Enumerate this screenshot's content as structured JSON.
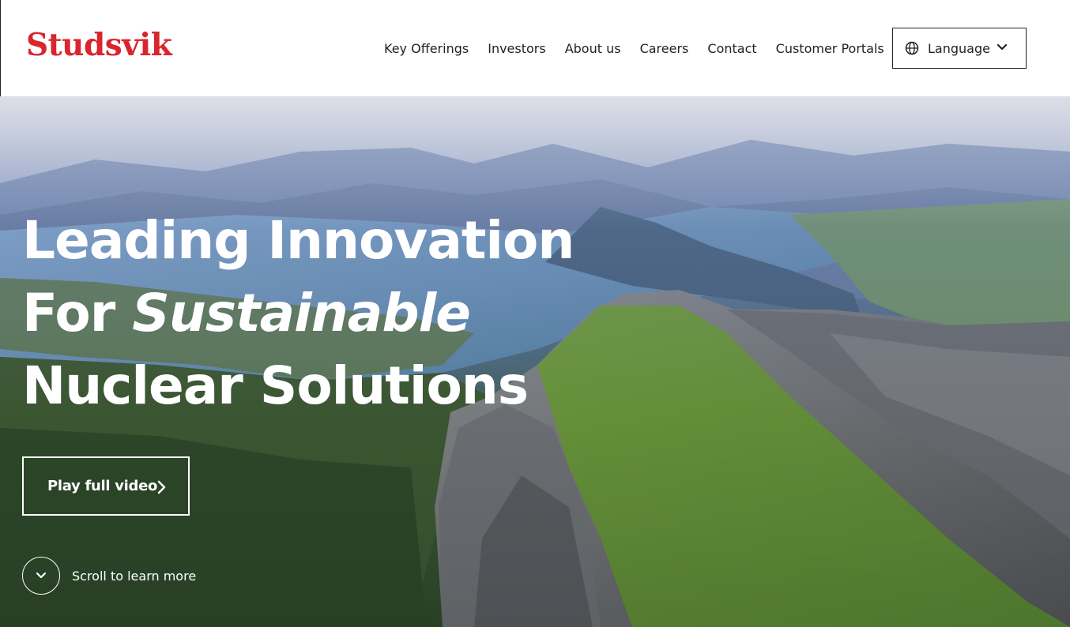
{
  "brand": {
    "logo_text": "Studsvik",
    "color": "#d9262e"
  },
  "nav": {
    "items": [
      {
        "label": "Key Offerings"
      },
      {
        "label": "Investors"
      },
      {
        "label": "About us"
      },
      {
        "label": "Careers"
      },
      {
        "label": "Contact"
      },
      {
        "label": "Customer Portals"
      }
    ],
    "language": {
      "label": "Language",
      "icon": "globe-icon",
      "dropdown_icon": "chevron-down-icon"
    }
  },
  "hero": {
    "headline_line1": "Leading Innovation",
    "headline_line2_prefix": "For ",
    "headline_line2_italic": "Sustainable",
    "headline_line3": "Nuclear Solutions",
    "play_button_label": "Play full video",
    "scroll_label": "Scroll to learn more",
    "background": "aerial-mountain-lake-landscape"
  }
}
